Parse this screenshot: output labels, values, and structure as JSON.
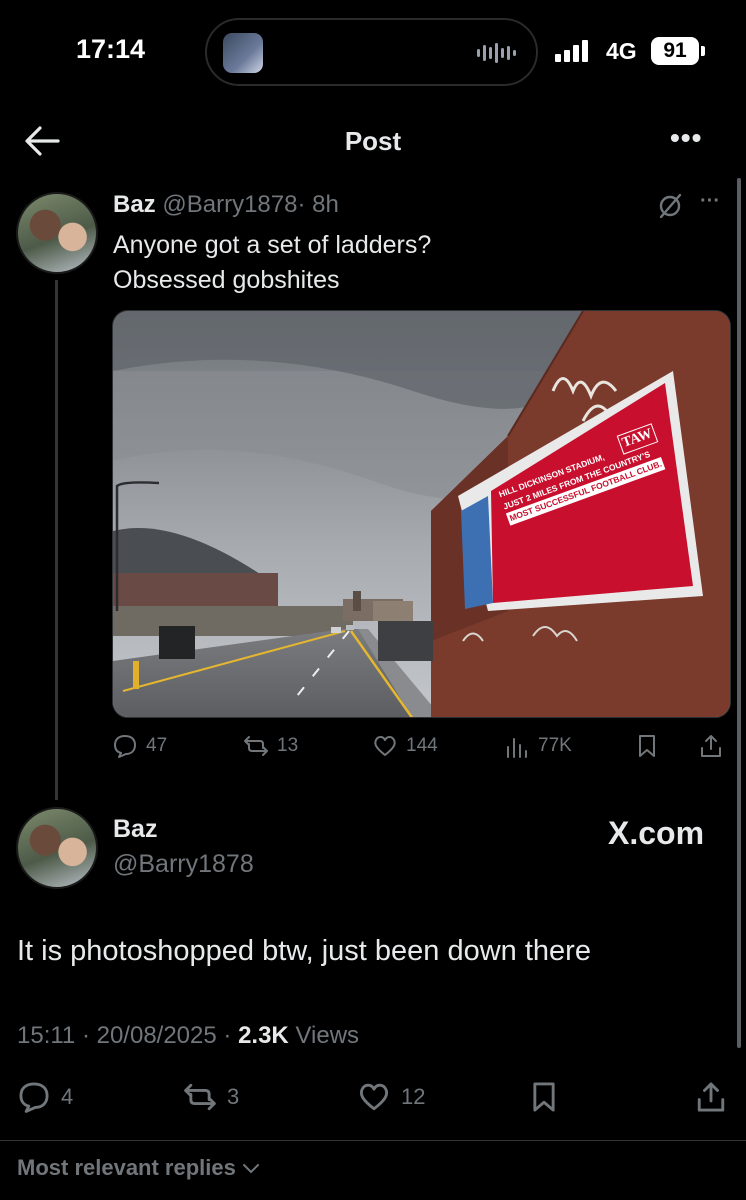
{
  "status_bar": {
    "time": "17:14",
    "network": "4G",
    "battery": "91"
  },
  "nav": {
    "title": "Post",
    "back_icon": "arrow-left-icon",
    "more_icon": "more-icon",
    "more_glyph": "•••"
  },
  "post": {
    "name": "Baz",
    "handle": "@Barry1878",
    "time": "· 8h",
    "text_line1": "Anyone got a set of ladders?",
    "text_line2": "Obsessed gobshites",
    "more_glyph": "···",
    "image": {
      "billboard_logo": "TAW",
      "billboard_line1": "HILL DICKINSON STADIUM,",
      "billboard_line2": "JUST 2 MILES FROM THE COUNTRY'S",
      "billboard_line3": "MOST SUCCESSFUL FOOTBALL CLUB."
    },
    "actions": {
      "replies": "47",
      "reposts": "13",
      "likes": "144",
      "views": "77K"
    }
  },
  "reply": {
    "name": "Baz",
    "handle": "@Barry1878",
    "watermark": "X.com",
    "text": "It is photoshopped btw, just been down there",
    "time": "15:11 · 20/08/2025 ·",
    "views_count": "2.3K",
    "views_label": "Views",
    "actions": {
      "replies": "4",
      "reposts": "3",
      "likes": "12"
    }
  },
  "footer": {
    "sort_label": "Most relevant replies"
  },
  "colors": {
    "background": "#000000",
    "text": "#e7e9ea",
    "muted": "#71767b",
    "billboard_red": "#c8102e"
  }
}
